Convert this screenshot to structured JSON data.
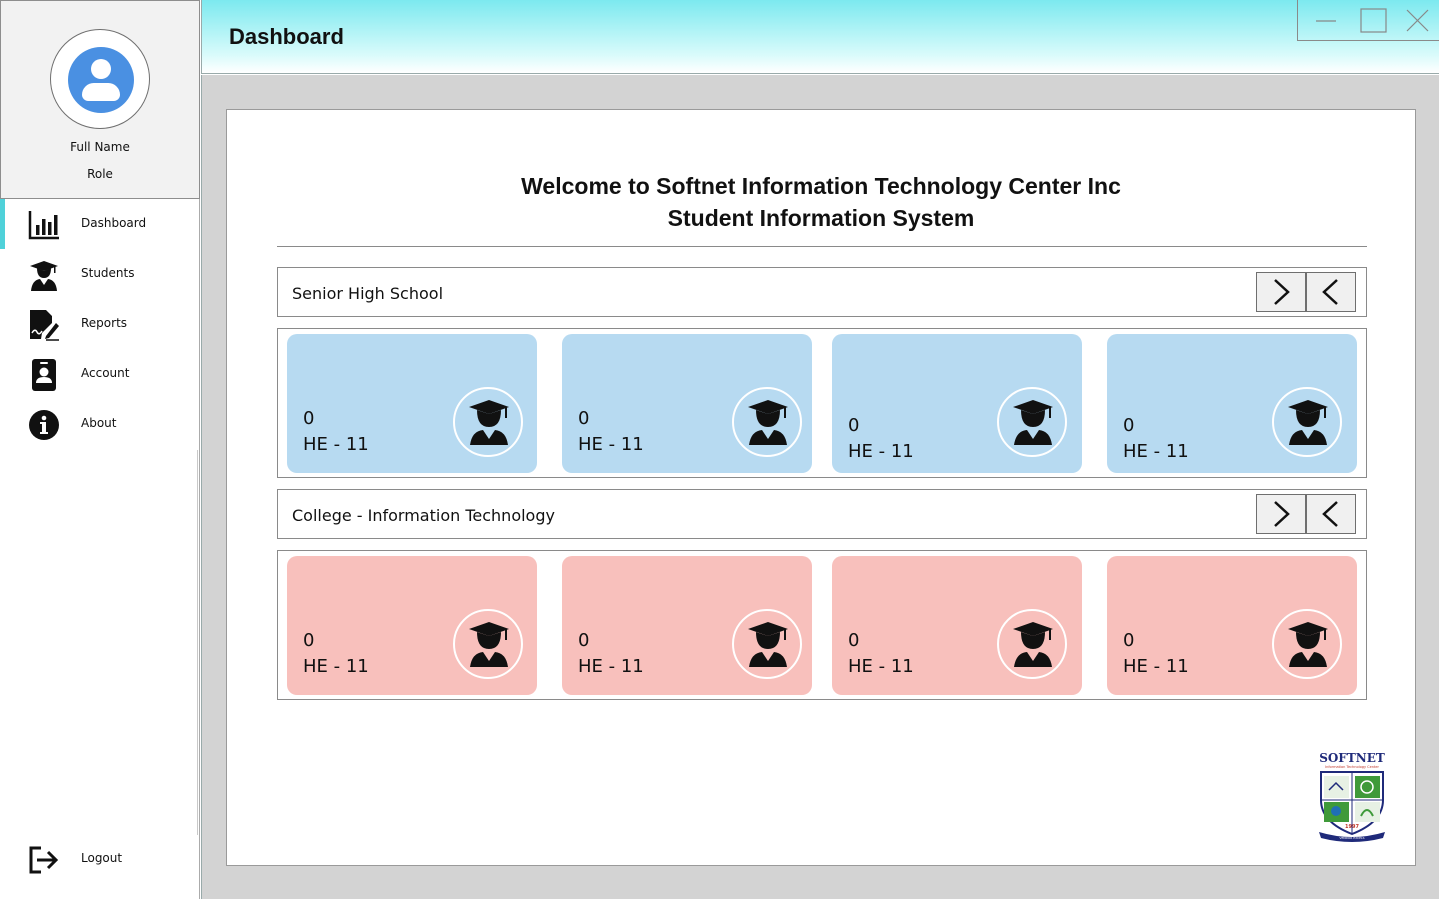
{
  "window": {
    "title": "Dashboard"
  },
  "profile": {
    "full_name": "Full Name",
    "role": "Role"
  },
  "nav": [
    {
      "label": "Dashboard",
      "icon": "bar-chart-icon",
      "active": true
    },
    {
      "label": "Students",
      "icon": "student-icon",
      "active": false
    },
    {
      "label": "Reports",
      "icon": "report-icon",
      "active": false
    },
    {
      "label": "Account",
      "icon": "id-card-icon",
      "active": false
    },
    {
      "label": "About",
      "icon": "info-icon",
      "active": false
    }
  ],
  "logout": {
    "label": "Logout"
  },
  "welcome": {
    "line1": "Welcome to Softnet Information Technology Center Inc",
    "line2": "Student Information System"
  },
  "sections": [
    {
      "title": "Senior High School",
      "color": "#b7daf1",
      "cards": [
        {
          "count": "0",
          "label": "HE - 11"
        },
        {
          "count": "0",
          "label": "HE - 11"
        },
        {
          "count": "0",
          "label": "HE - 11"
        },
        {
          "count": "0",
          "label": "HE - 11"
        }
      ]
    },
    {
      "title": "College - Information Technology",
      "color": "#f8c0bc",
      "cards": [
        {
          "count": "0",
          "label": "HE - 11"
        },
        {
          "count": "0",
          "label": "HE - 11"
        },
        {
          "count": "0",
          "label": "HE - 11"
        },
        {
          "count": "0",
          "label": "HE - 11"
        }
      ]
    }
  ],
  "logo": {
    "text": "SOFTNET",
    "subtitle": "Information Technology Center",
    "year": "1997",
    "motto": "VENDOR EXCELS"
  }
}
